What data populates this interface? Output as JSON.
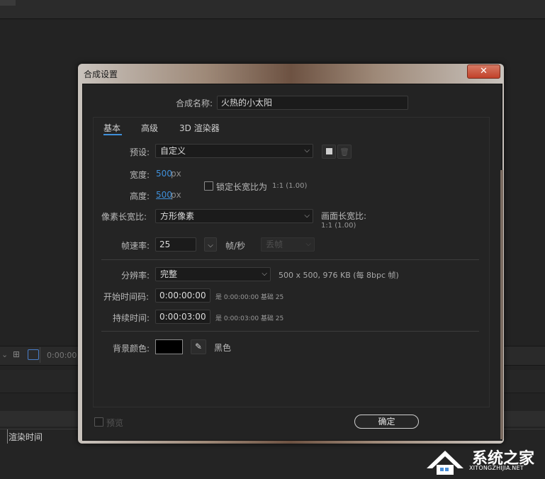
{
  "background": {
    "timecode": "0:00:00",
    "render_time_label": "渲染时间"
  },
  "dialog": {
    "title": "合成设置",
    "close_symbol": "✕",
    "comp_name_label": "合成名称:",
    "comp_name_value": "火热的小太阳",
    "tabs": [
      "基本",
      "高级",
      "3D 渲染器"
    ],
    "active_tab": "基本",
    "preset_label": "预设:",
    "preset_value": "自定义",
    "width_label": "宽度:",
    "width_value": "500",
    "height_label": "高度:",
    "height_value": "500",
    "unit_px": "px",
    "lock_aspect_label": "锁定长宽比为",
    "lock_aspect_value": "1:1 (1.00)",
    "pixel_aspect_label": "像素长宽比:",
    "pixel_aspect_value": "方形像素",
    "frame_aspect_label": "画面长宽比:",
    "frame_aspect_value": "1:1 (1.00)",
    "frame_rate_label": "帧速率:",
    "frame_rate_value": "25",
    "frame_rate_unit": "帧/秒",
    "drop_frame_value": "丢帧",
    "resolution_label": "分辨率:",
    "resolution_value": "完整",
    "resolution_info": "500 x 500, 976 KB (每 8bpc 帧)",
    "start_timecode_label": "开始时间码:",
    "start_timecode_value": "0:00:00:00",
    "start_timecode_note": "是 0:00:00:00  基础 25",
    "duration_label": "持续时间:",
    "duration_value": "0:00:03:00",
    "duration_note": "是 0:00:03:00  基础 25",
    "bg_color_label": "背景颜色:",
    "bg_color_name": "黑色",
    "bg_color_hex": "#000000",
    "preview_label": "预览",
    "ok_label": "确定"
  },
  "watermark": {
    "title": "系统之家",
    "subtitle": "XITONGZHIJIA.NET"
  },
  "colors": {
    "accent": "#3f8fd9",
    "close": "#c2412a"
  }
}
